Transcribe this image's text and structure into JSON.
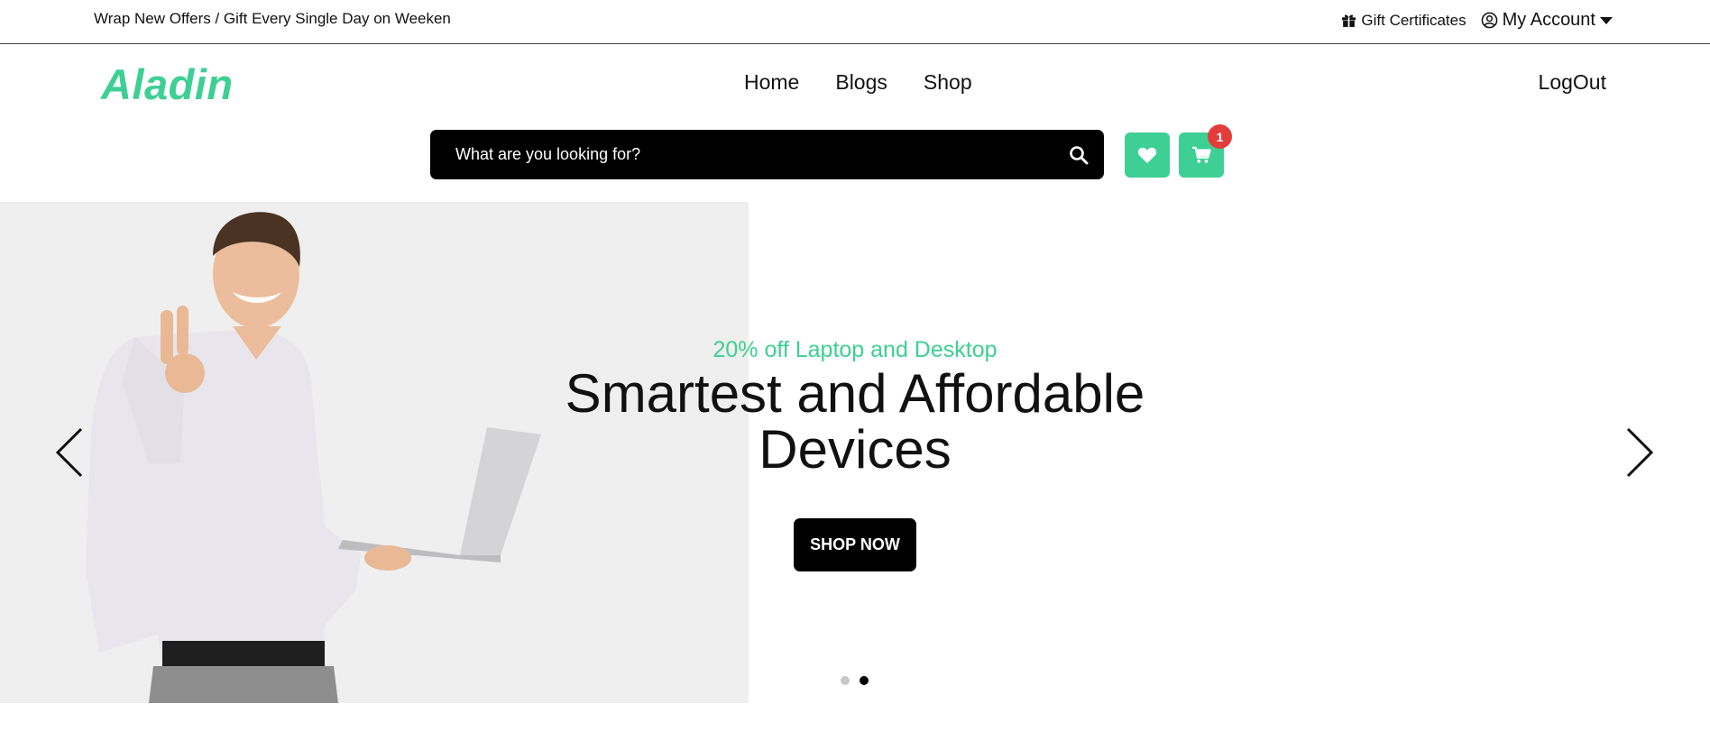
{
  "topbar": {
    "promo": "Wrap New Offers / Gift Every Single Day on Weeken",
    "gift_label": "Gift Certificates",
    "account_label": "My Account"
  },
  "header": {
    "logo": "Aladin",
    "nav": [
      {
        "label": "Home"
      },
      {
        "label": "Blogs"
      },
      {
        "label": "Shop"
      }
    ],
    "logout_label": "LogOut"
  },
  "search": {
    "placeholder": "What are you looking for?"
  },
  "cart": {
    "count": "1"
  },
  "hero": {
    "subtitle": "20% off Laptop and Desktop",
    "title": "Smartest and Affordable Devices",
    "button_label": "SHOP NOW",
    "slide_count": 2,
    "active_slide": 2
  },
  "colors": {
    "accent": "#3ecf95",
    "badge": "#e43b3b",
    "dark": "#000000"
  }
}
